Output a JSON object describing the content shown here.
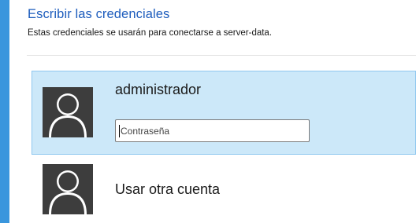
{
  "dialog": {
    "title": "Escribir las credenciales",
    "subtitle": "Estas credenciales se usarán para conectarse a server-data."
  },
  "accounts": [
    {
      "name": "administrador",
      "selected": true,
      "avatar_icon": "user-icon",
      "password": {
        "value": "",
        "placeholder": "Contraseña"
      }
    },
    {
      "name": "Usar otra cuenta",
      "selected": false,
      "avatar_icon": "user-icon"
    }
  ],
  "colors": {
    "accent": "#3a96dd",
    "title": "#1e5dbd",
    "selected_tile": "#cce8f9",
    "selected_border": "#8ec7ef",
    "avatar_bg": "#3d3d3d"
  }
}
